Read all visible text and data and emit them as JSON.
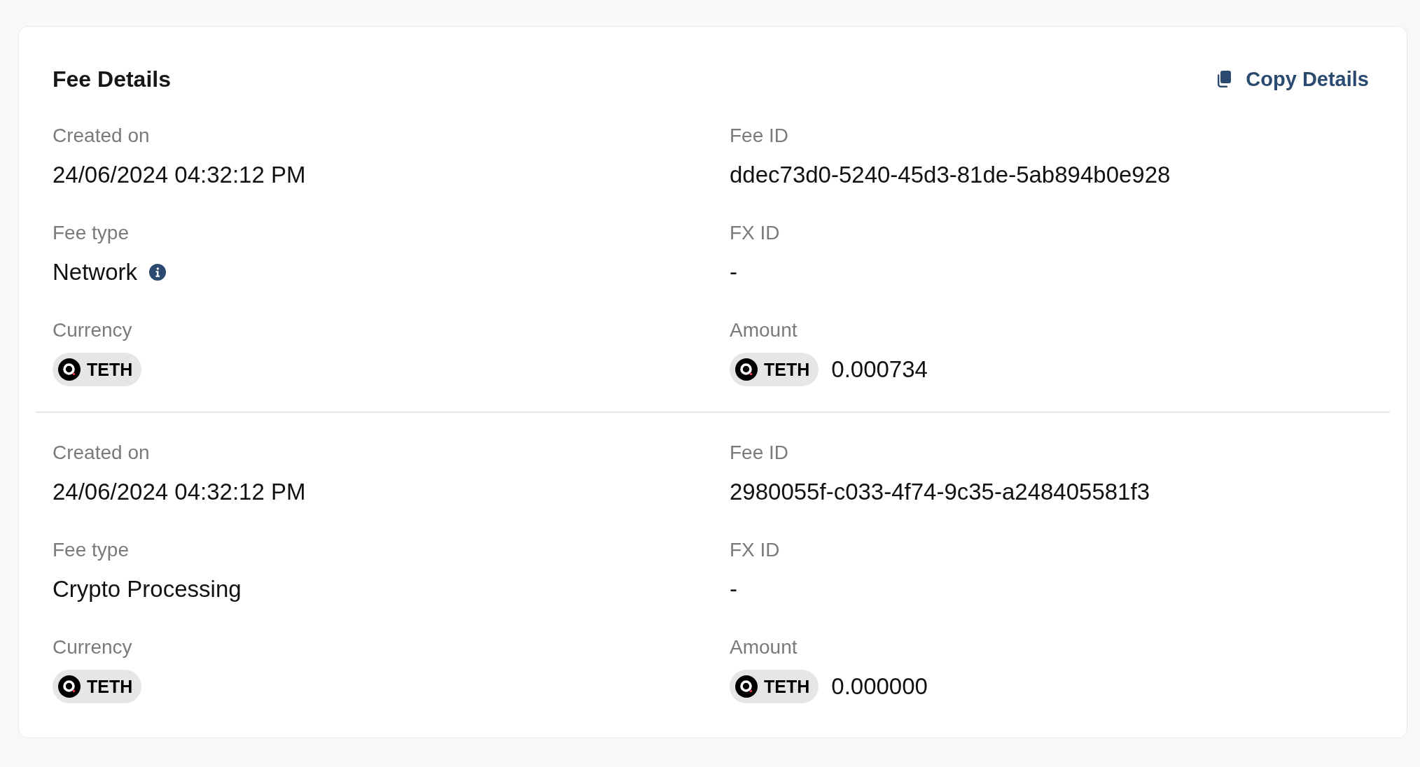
{
  "card": {
    "title": "Fee Details",
    "copy_button": {
      "label": "Copy Details"
    }
  },
  "fees": [
    {
      "fields": [
        {
          "kind": "text",
          "label": "Created on",
          "value": "24/06/2024 04:32:12 PM",
          "info": false
        },
        {
          "kind": "text",
          "label": "Fee ID",
          "value": "ddec73d0-5240-45d3-81de-5ab894b0e928",
          "info": false
        },
        {
          "kind": "text",
          "label": "Fee type",
          "value": "Network",
          "info": true
        },
        {
          "kind": "text",
          "label": "FX ID",
          "value": "-",
          "info": false
        },
        {
          "kind": "currency",
          "label": "Currency",
          "currency": "TETH",
          "info": false
        },
        {
          "kind": "amount",
          "label": "Amount",
          "currency": "TETH",
          "value": "0.000734",
          "info": false
        }
      ]
    },
    {
      "fields": [
        {
          "kind": "text",
          "label": "Created on",
          "value": "24/06/2024 04:32:12 PM",
          "info": false
        },
        {
          "kind": "text",
          "label": "Fee ID",
          "value": "2980055f-c033-4f74-9c35-a248405581f3",
          "info": false
        },
        {
          "kind": "text",
          "label": "Fee type",
          "value": "Crypto Processing",
          "info": false
        },
        {
          "kind": "text",
          "label": "FX ID",
          "value": "-",
          "info": false
        },
        {
          "kind": "currency",
          "label": "Currency",
          "currency": "TETH",
          "info": false
        },
        {
          "kind": "amount",
          "label": "Amount",
          "currency": "TETH",
          "value": "0.000000",
          "info": false
        }
      ]
    }
  ]
}
